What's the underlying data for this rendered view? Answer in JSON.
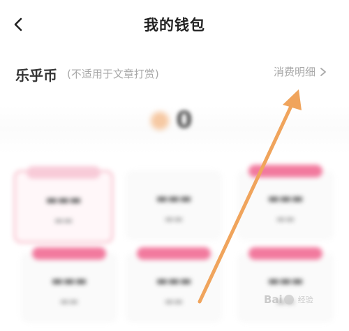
{
  "header": {
    "title": "我的钱包"
  },
  "coin_section": {
    "title": "乐乎币",
    "note": "(不适用于文章打赏)",
    "detail_link": "消费明细"
  },
  "balance": {
    "value": "0"
  },
  "watermark": {
    "text": "Bai",
    "suffix": "经验"
  },
  "colors": {
    "accent_pink": "#f27a9e",
    "arrow_orange": "#f0a45c",
    "muted_text": "#a8a8a8"
  }
}
